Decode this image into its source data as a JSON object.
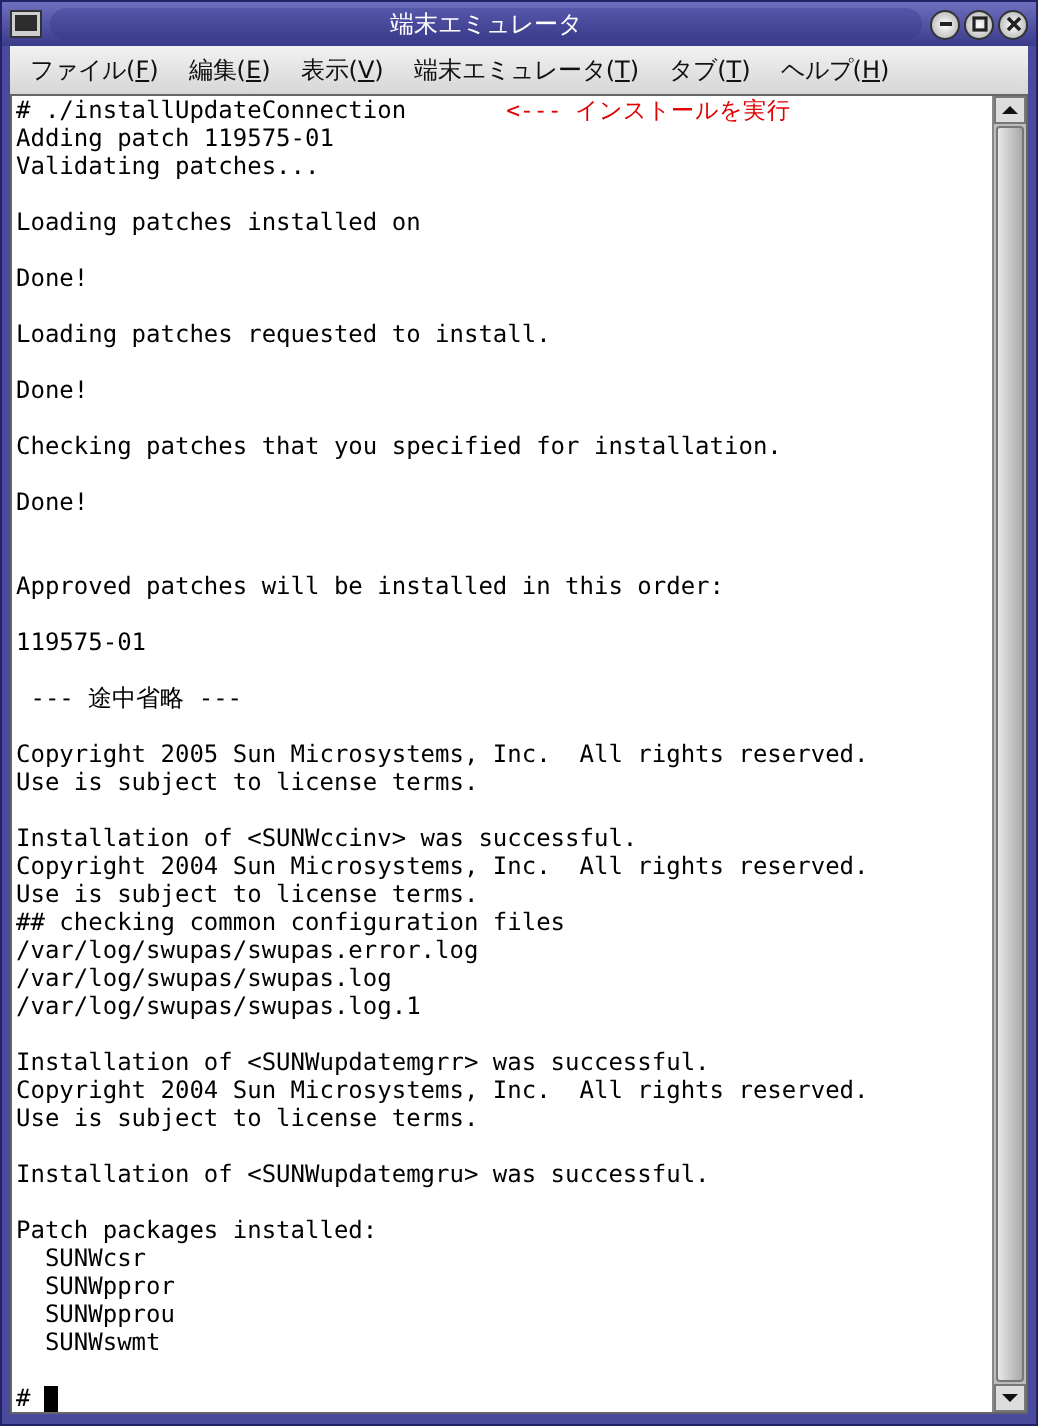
{
  "window": {
    "title": "端末エミュレータ"
  },
  "menu": [
    {
      "label": "ファイル(",
      "key": "F",
      "tail": ")"
    },
    {
      "label": "編集(",
      "key": "E",
      "tail": ")"
    },
    {
      "label": "表示(",
      "key": "V",
      "tail": ")"
    },
    {
      "label": "端末エミュレータ(",
      "key": "T",
      "tail": ")"
    },
    {
      "label": "タブ(",
      "key": "T",
      "tail": ")"
    },
    {
      "label": "ヘルプ(",
      "key": "H",
      "tail": ")"
    }
  ],
  "terminal": {
    "lines": [
      {
        "kind": "text",
        "text": "# ./installUpdateConnection",
        "note": "<--- インストールを実行"
      },
      {
        "kind": "text",
        "text": "Adding patch 119575-01"
      },
      {
        "kind": "text",
        "text": "Validating patches..."
      },
      {
        "kind": "blank"
      },
      {
        "kind": "text",
        "text": "Loading patches installed on"
      },
      {
        "kind": "blank"
      },
      {
        "kind": "text",
        "text": "Done!"
      },
      {
        "kind": "blank"
      },
      {
        "kind": "text",
        "text": "Loading patches requested to install."
      },
      {
        "kind": "blank"
      },
      {
        "kind": "text",
        "text": "Done!"
      },
      {
        "kind": "blank"
      },
      {
        "kind": "text",
        "text": "Checking patches that you specified for installation."
      },
      {
        "kind": "blank"
      },
      {
        "kind": "text",
        "text": "Done!"
      },
      {
        "kind": "blank"
      },
      {
        "kind": "blank"
      },
      {
        "kind": "text",
        "text": "Approved patches will be installed in this order:"
      },
      {
        "kind": "blank"
      },
      {
        "kind": "text",
        "text": "119575-01"
      },
      {
        "kind": "blank"
      },
      {
        "kind": "text",
        "text": " --- 途中省略 ---"
      },
      {
        "kind": "blank"
      },
      {
        "kind": "text",
        "text": "Copyright 2005 Sun Microsystems, Inc.  All rights reserved."
      },
      {
        "kind": "text",
        "text": "Use is subject to license terms."
      },
      {
        "kind": "blank"
      },
      {
        "kind": "text",
        "text": "Installation of <SUNWccinv> was successful."
      },
      {
        "kind": "text",
        "text": "Copyright 2004 Sun Microsystems, Inc.  All rights reserved."
      },
      {
        "kind": "text",
        "text": "Use is subject to license terms."
      },
      {
        "kind": "text",
        "text": "## checking common configuration files"
      },
      {
        "kind": "text",
        "text": "/var/log/swupas/swupas.error.log"
      },
      {
        "kind": "text",
        "text": "/var/log/swupas/swupas.log"
      },
      {
        "kind": "text",
        "text": "/var/log/swupas/swupas.log.1"
      },
      {
        "kind": "blank"
      },
      {
        "kind": "text",
        "text": "Installation of <SUNWupdatemgrr> was successful."
      },
      {
        "kind": "text",
        "text": "Copyright 2004 Sun Microsystems, Inc.  All rights reserved."
      },
      {
        "kind": "text",
        "text": "Use is subject to license terms."
      },
      {
        "kind": "blank"
      },
      {
        "kind": "text",
        "text": "Installation of <SUNWupdatemgru> was successful."
      },
      {
        "kind": "blank"
      },
      {
        "kind": "text",
        "text": "Patch packages installed:"
      },
      {
        "kind": "text",
        "text": "  SUNWcsr"
      },
      {
        "kind": "text",
        "text": "  SUNWppror"
      },
      {
        "kind": "text",
        "text": "  SUNWpprou"
      },
      {
        "kind": "text",
        "text": "  SUNWswmt"
      },
      {
        "kind": "blank"
      },
      {
        "kind": "prompt",
        "text": "#"
      }
    ]
  }
}
